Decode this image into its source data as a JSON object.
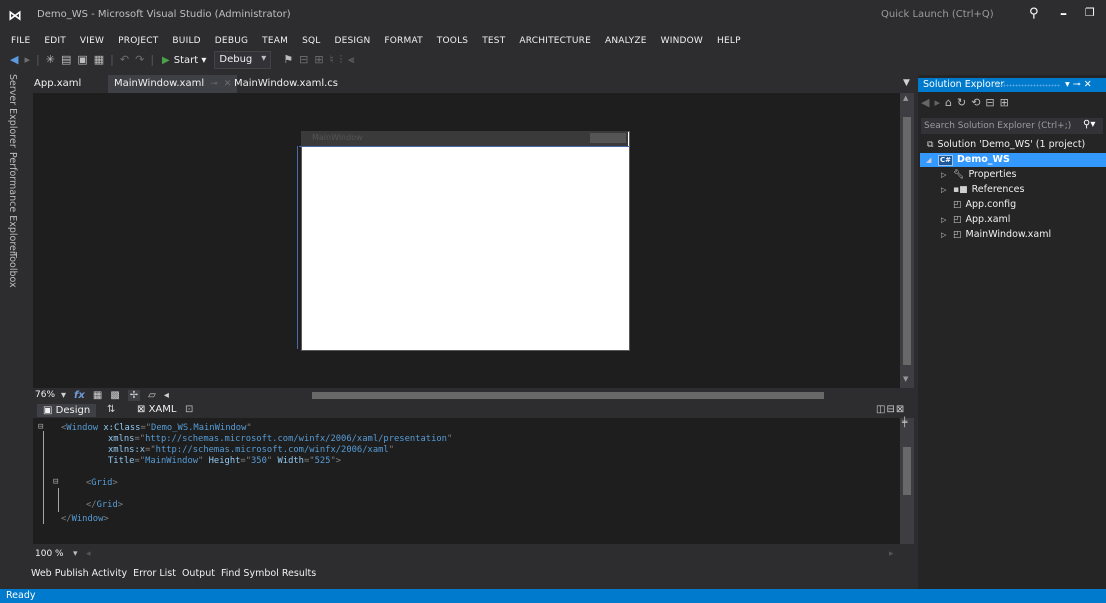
{
  "titlebar": {
    "title": "Demo_WS - Microsoft Visual Studio (Administrator)",
    "quick_launch_placeholder": "Quick Launch (Ctrl+Q)"
  },
  "menu": [
    "FILE",
    "EDIT",
    "VIEW",
    "PROJECT",
    "BUILD",
    "DEBUG",
    "TEAM",
    "SQL",
    "DESIGN",
    "FORMAT",
    "TOOLS",
    "TEST",
    "ARCHITECTURE",
    "ANALYZE",
    "WINDOW",
    "HELP"
  ],
  "toolbar": {
    "start_label": "Start",
    "configuration": "Debug"
  },
  "left_dock": [
    "Server Explorer",
    "Performance Explorer",
    "Toolbox"
  ],
  "doc_tabs": [
    {
      "label": "App.xaml",
      "active": false
    },
    {
      "label": "MainWindow.xaml",
      "active": true
    },
    {
      "label": "MainWindow.xaml.cs",
      "active": false
    }
  ],
  "designer": {
    "zoom": "76%",
    "window_title": "MainWindow"
  },
  "split": {
    "design_label": "Design",
    "xaml_label": "XAML"
  },
  "code": {
    "l1": {
      "tag": "Window",
      "attr": "x:Class",
      "val": "Demo_WS.MainWindow"
    },
    "l2": {
      "attr": "xmlns",
      "val": "http://schemas.microsoft.com/winfx/2006/xaml/presentation"
    },
    "l3": {
      "attr": "xmlns:x",
      "val": "http://schemas.microsoft.com/winfx/2006/xaml"
    },
    "l4": {
      "attr1": "Title",
      "val1": "MainWindow",
      "attr2": "Height",
      "val2": "350",
      "attr3": "Width",
      "val3": "525"
    },
    "l5": {
      "tag": "Grid"
    },
    "l7": {
      "tag": "Grid"
    },
    "l8": {
      "tag": "Window"
    }
  },
  "editor": {
    "zoom": "100 %"
  },
  "bottom_tabs": [
    "Web Publish Activity",
    "Error List",
    "Output",
    "Find Symbol Results"
  ],
  "status": "Ready",
  "solution_explorer": {
    "title": "Solution Explorer",
    "search_placeholder": "Search Solution Explorer (Ctrl+;)",
    "items": [
      {
        "label": "Solution 'Demo_WS' (1 project)"
      },
      {
        "label": "Demo_WS"
      },
      {
        "label": "Properties"
      },
      {
        "label": "References"
      },
      {
        "label": "App.config"
      },
      {
        "label": "App.xaml"
      },
      {
        "label": "MainWindow.xaml"
      }
    ]
  },
  "colors": {
    "accent": "#007acc",
    "background": "#2d2d30",
    "editor_bg": "#1e1e1e",
    "selection": "#3399ff"
  }
}
